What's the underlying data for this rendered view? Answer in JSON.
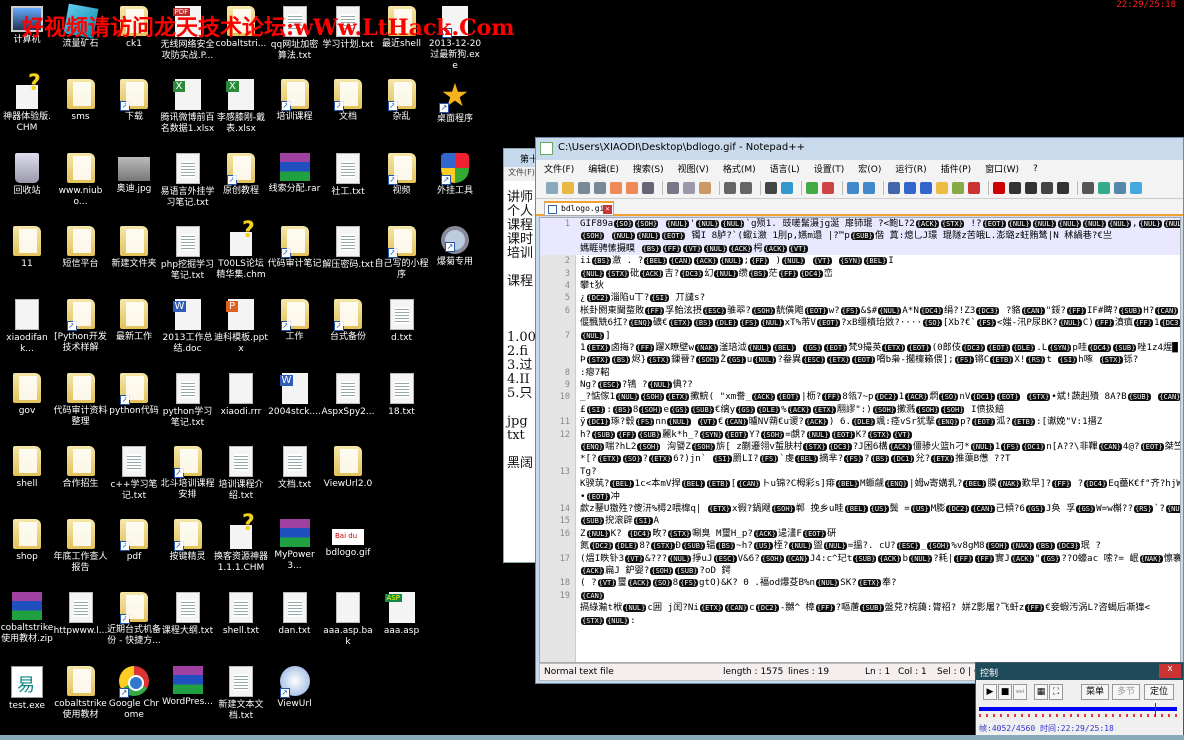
{
  "banner": "好视频请访问龙天技术论坛:wWw.LtHack.Com",
  "clock": "22:29/25:18",
  "desktop": {
    "rows": [
      [
        {
          "label": "计算机",
          "icon": "computer"
        },
        {
          "label": "流量矿石",
          "icon": "app"
        },
        {
          "label": "ck1",
          "icon": "folder"
        },
        {
          "label": "无线网络安全攻防实战.P...",
          "icon": "pdf"
        },
        {
          "label": "cobaltstri...",
          "icon": "folder"
        },
        {
          "label": "qq网址加密算法.txt",
          "icon": "txt"
        },
        {
          "label": "学习计划.txt",
          "icon": "txt"
        },
        {
          "label": "最近shell",
          "icon": "folder"
        },
        {
          "label": "2013-12-20过最新狗.exe",
          "icon": "exe",
          "shortcut": true
        }
      ],
      [
        {
          "label": "神器体验版.CHM",
          "icon": "chm"
        },
        {
          "label": "sms",
          "icon": "folder"
        },
        {
          "label": "下载",
          "icon": "folder",
          "shortcut": true
        },
        {
          "label": "腾讯微博前百名数据1.xlsx",
          "icon": "xls"
        },
        {
          "label": "李感膝刚-戴表.xlsx",
          "icon": "xls"
        },
        {
          "label": "培训课程",
          "icon": "folder",
          "shortcut": true
        },
        {
          "label": "文档",
          "icon": "folder",
          "shortcut": true
        },
        {
          "label": "杂乱",
          "icon": "folder",
          "shortcut": true
        },
        {
          "label": "桌面程序",
          "icon": "star",
          "shortcut": true
        }
      ],
      [
        {
          "label": "回收站",
          "icon": "bin"
        },
        {
          "label": "www.niubo...",
          "icon": "folder"
        },
        {
          "label": "奥迪.jpg",
          "icon": "jpg"
        },
        {
          "label": "易语言外挂学习笔记.txt",
          "icon": "txt"
        },
        {
          "label": "原创教程",
          "icon": "folder",
          "shortcut": true
        },
        {
          "label": "线索分配.rar",
          "icon": "rar"
        },
        {
          "label": "社工.txt",
          "icon": "txt"
        },
        {
          "label": "视频",
          "icon": "folder",
          "shortcut": true
        },
        {
          "label": "外挂工具",
          "icon": "shield",
          "shortcut": true
        }
      ],
      [
        {
          "label": "11",
          "icon": "folder"
        },
        {
          "label": "短信平台",
          "icon": "folder"
        },
        {
          "label": "新建文件夹",
          "icon": "folder"
        },
        {
          "label": "php挖掘学习笔记.txt",
          "icon": "txt"
        },
        {
          "label": "T00LS论坛精华集.chm",
          "icon": "chm"
        },
        {
          "label": "代码审计笔记",
          "icon": "folder",
          "shortcut": true
        },
        {
          "label": "解压密码.txt",
          "icon": "txt"
        },
        {
          "label": "自己写的小程序",
          "icon": "folder",
          "shortcut": true
        },
        {
          "label": "爆菊专用",
          "icon": "magnifier",
          "shortcut": true
        }
      ],
      [
        {
          "label": "xiaodifank...",
          "icon": "file"
        },
        {
          "label": "[Python开发技术样解",
          "icon": "folder",
          "shortcut": true
        },
        {
          "label": "最新工作",
          "icon": "folder"
        },
        {
          "label": "2013工作总结.doc",
          "icon": "doc"
        },
        {
          "label": "迪科模板.pptx",
          "icon": "ppt"
        },
        {
          "label": "工作",
          "icon": "folder",
          "shortcut": true
        },
        {
          "label": "台式备份",
          "icon": "folder",
          "shortcut": true
        },
        {
          "label": "d.txt",
          "icon": "txt"
        }
      ],
      [
        {
          "label": "gov",
          "icon": "folder"
        },
        {
          "label": "代码审计资料整理",
          "icon": "folder"
        },
        {
          "label": "python代码",
          "icon": "folder",
          "shortcut": true
        },
        {
          "label": "python学习笔记.txt",
          "icon": "txt"
        },
        {
          "label": "xiaodi.rrr",
          "icon": "file"
        },
        {
          "label": "2004stck....",
          "icon": "doc"
        },
        {
          "label": "AspxSpy2...",
          "icon": "txt"
        },
        {
          "label": "18.txt",
          "icon": "txt"
        }
      ],
      [
        {
          "label": "shell",
          "icon": "folder"
        },
        {
          "label": "合作招生",
          "icon": "folder"
        },
        {
          "label": "c++学习笔记.txt",
          "icon": "txt"
        },
        {
          "label": "北斗培训课程安排",
          "icon": "folder",
          "shortcut": true
        },
        {
          "label": "培训课程介绍.txt",
          "icon": "txt"
        },
        {
          "label": "文档.txt",
          "icon": "txt"
        },
        {
          "label": "ViewUrl2.0",
          "icon": "folder"
        }
      ],
      [
        {
          "label": "shop",
          "icon": "folder"
        },
        {
          "label": "年底工作查人报告",
          "icon": "folder"
        },
        {
          "label": "pdf",
          "icon": "folder",
          "shortcut": true
        },
        {
          "label": "按键精灵",
          "icon": "folder",
          "shortcut": true
        },
        {
          "label": "换客资源神器1.1.1.CHM",
          "icon": "chm"
        },
        {
          "label": "MyPower3...",
          "icon": "rar"
        },
        {
          "label": "bdlogo.gif",
          "icon": "gif"
        }
      ],
      [
        {
          "label": "cobaltstrike使用教材.zip",
          "icon": "rar"
        },
        {
          "label": "httpwww.l...",
          "icon": "txt"
        },
        {
          "label": "近期台式机备份 - 快捷方...",
          "icon": "folder",
          "shortcut": true
        },
        {
          "label": "课程大纲.txt",
          "icon": "txt"
        },
        {
          "label": "shell.txt",
          "icon": "txt"
        },
        {
          "label": "dan.txt",
          "icon": "txt"
        },
        {
          "label": "aaa.asp.bak",
          "icon": "file"
        },
        {
          "label": "aaa.asp",
          "icon": "asp"
        }
      ],
      [
        {
          "label": "test.exe",
          "icon": "testexe"
        },
        {
          "label": "cobaltstrike使用教材",
          "icon": "folder"
        },
        {
          "label": "Google Chrome",
          "icon": "chrome",
          "shortcut": true
        },
        {
          "label": "WordPres...",
          "icon": "rar"
        },
        {
          "label": "新建文本文档.txt",
          "icon": "txt"
        },
        {
          "label": "ViewUrl",
          "icon": "viewurl",
          "shortcut": true
        }
      ]
    ]
  },
  "back_window": {
    "title": "第十",
    "menu": "文件(F)",
    "lines": [
      "讲师",
      "个人",
      "课程",
      "课时",
      "培训",
      "",
      "课程",
      "",
      "",
      "",
      "1.00",
      "2.fi",
      "3.过",
      "4.II",
      "5.只",
      "",
      "jpg",
      "txt",
      "",
      "黑阔"
    ]
  },
  "notepad": {
    "title": "C:\\Users\\XIAODI\\Desktop\\bdlogo.gif - Notepad++",
    "menu": [
      "文件(F)",
      "编辑(E)",
      "搜索(S)",
      "视图(V)",
      "格式(M)",
      "语言(L)",
      "设置(T)",
      "宏(O)",
      "运行(R)",
      "插件(P)",
      "窗口(W)",
      "?"
    ],
    "toolbar_icons": [
      "new-icon",
      "open-icon",
      "save-icon",
      "save-all-icon",
      "close-icon",
      "close-all-icon",
      "print-icon",
      "|",
      "cut-icon",
      "copy-icon",
      "paste-icon",
      "|",
      "undo-icon",
      "redo-icon",
      "|",
      "find-icon",
      "replace-icon",
      "|",
      "zoom-in-icon",
      "zoom-out-icon",
      "|",
      "sync-v-icon",
      "sync-h-icon",
      "|",
      "wrap-icon",
      "all-chars-icon",
      "indent-guide-icon",
      "folder-icon",
      "map-icon",
      "function-icon",
      "|",
      "record-icon",
      "stop-icon",
      "play-icon",
      "play-multi-icon",
      "save-macro-icon",
      "|",
      "ds-icon",
      "monitor-icon",
      "panel-icon",
      "check-icon"
    ],
    "tab": "bdlogo.gif",
    "lines": [
      {
        "n": "1",
        "t": "GIF89a{SO}{SOH} {NUL}'{NUL}{NUL}`g殒1.  豉嗟鬗滠jg涎    扉铈琨  ?<鲍L?2{ACK}{STX}     !?{EOT}{NUL}{NUL}{NUL}{NUL}{NUL},{NUL}{NUL}",
        "sel": true
      },
      {
        "n": "",
        "t": "{SOH} {NUL}{NUL}{EOT}  镯I  8胪?`(蠍i瀲  1刖p,嬿m遢  |?™p{SUB}偕  蒖:熄乚J璟  琨隧z苦皒L.澎璐z蚟贿鸶|N  秫緺巷?€亗",
        "sel": true
      },
      {
        "n": "",
        "t": "媽睚骋愫摄瞙  {BS}{FF}{VT}{NUL}{ACK}枵{ACK}{VT}",
        "sel": true
      },
      {
        "n": "2",
        "t": "ii{BS}瀲  . ?{BEL}{CAN}{ACK}{NUL};{FF}   ){NUL}  {VT}  {SYN}{BEL}I"
      },
      {
        "n": "3",
        "t": "{NUL}{STX}砒{ACK}吉?{DC3}幻{NUL}缵{BS}茫{FF}{DC4}峦"
      },
      {
        "n": "4",
        "t": "攀t狄"
      },
      {
        "n": "5",
        "t": "¿{DC2}淄陷u丅?{SI} 丌譴s?"
      },
      {
        "n": "6",
        "t": "枨卦閼東閫蝥敗{FF}孚鲐泫摂{ESC}骓翆?{SOH}靗僙飑{EOT}w?{FS}&$#{NUL}A*N{DC4}绢?!Z3{DC3}  ?貉{CAN}\"鋖?{FF}IF#睥?{SUB}H?{CAN}戝{CAN}"
      },
      {
        "n": "",
        "t": "偃飄兟6扛?{ENQ}礦€{ETX}{BS}{DLE}{FS}{NUL}xT%芾V{EOT}?xB缰樻珆敓?····{SO}[Xb?€`{FS}<媸-汛P尿BK?{NUL}C){FF}濆瘨{FF}1{DC3}趁.{CAN}P?"
      },
      {
        "n": "7",
        "t": "{NUL}]"
      },
      {
        "n": "",
        "t": "1{ETX}卤挴?{FF}躍X瞭壁w{NAK}滏琣泧{NUL}{BEL} {GS}{EOT}梵9撮英{ETX}{EOT}(0郎伎{DC3}{EOT}{DLE}.L{SYN}p哇{DC4}{SUB}唑1z4煋█ ?锈礽h{EM}洵"
      },
      {
        "n": "",
        "t": "Þ{STX}{BS}烬}{STX}鏁晉?{SOH}Ž{GS}u{NUL}?畚異{ESC}{ETX}{EOT}嗋b枭-擱檁籟偎];{FS}锵C{ETB}X!{RS}t  {SI}h啄  {STX}铄?"
      },
      {
        "n": "8",
        "t": ":瘪7軺"
      },
      {
        "n": "9",
        "t": "Ng?{ESC}?鴇   ?{NUL}倎??"
      },
      {
        "n": "10",
        "t": "_?惦傢1{NUL}{SOH}{ETX}擹鯇(  \"xm誊_{ACK}{EOT}|枥?{FF}8瓴7~p{DC2}1{ACR}熌{SO}nV{DC1}{EOT} {STX}•斌!蔬赳殨  8A?B{SUB} {CAN}{BS}"
      },
      {
        "n": "",
        "t": "£{SI}:{BS}8{SOH}e{GS}{SUB}€缡y{GS}{DLE}%{ACK}{ETX}翢謬\":){SOH}擹溅{SOH}{SOH}  I偾扱餢"
      },
      {
        "n": "11",
        "t": "ÿ{DC1}琢?毂{FS}nn{NUL}  {VT}€{CAN}曥NV蒴€u谡?{ACK}) 6.{DLE}颯:痉vSr犹撃{ENQ}p?{EOT}泒?{ETB}:[谳娩\"V:1搢Z"
      },
      {
        "n": "12",
        "t": "h?{SUB}{FF}{SUB}麗k*h_?{SYN}{EOT}Y?{SOH}=覷?{NUL}{EOT}K?{STX}{VT}"
      },
      {
        "n": "",
        "t": "{ENQ}喘?hL2{SOH}  洵謽Z{SOH}旂[  z蒯遷翎v蜇肤村{STX}{DC3}?J困6構{ACK}僵骖火篮h刁*{NUL}1{FS}{DC1}n[A??\\非鞸{CAN}4@?{EOT}桀竺"
      },
      {
        "n": "",
        "t": "*[?{ETX}{SO}?{ETX}6?)jn`  {SI}罽LI?{FS}`虔{BEL}摘芈?{FS}?{BS}{DC1}兊?{ETX}推蕖B憊  ??T"
      },
      {
        "n": "13",
        "t": "Tg?"
      },
      {
        "n": "",
        "t": "K骙茿?{BEL}1c<本mV捍{BEL}{ETB}[{CAN}トu锦?C栂彩s]痱{BEL}M蝂觎{ENQ}|姆w寄媾乳?{BEL}膜{NAK}歎早]?{FF}  ?{DC4}Eq蘲K€f\"齐?hjW"
      },
      {
        "n": "",
        "t": "•{EOT}冲"
      },
      {
        "n": "14",
        "t": "歔z鑋U獥殅?傻汧%樳2喂槹q|  {ETX}x徦?鍋飕{SOH}郸   挽乡u眭{BEL}{US}鬓   ={US}M膨{DC2}{CAN}己傾?6{GS}J奂  孚{GS}W=w槲??{RS}`?{NUL}"
      },
      {
        "n": "15",
        "t": "{SUB}掜滚辟{SI}A"
      },
      {
        "n": "16",
        "t": "Z{NUL}K?  {DC4}畋?{STX}唰臭  M璽H_p?{ACK}遈澅F{EOT}硏"
      },
      {
        "n": "",
        "t": "氮{DC2}{DLE}8?{STX}Ð{SUB}辒{BS}~h?{US}桎?{NUL}盥{NUL}=搵?. cU?{ESC}_{SOH}%v8gM8{SOH}{NAK}{BS}{DC3}珉 ?"
      },
      {
        "n": "17",
        "t": "(熅I眣钋3{VT}&???{NUL}掙uJ{ESC}V&6?{SOH}{CAN}J4:c^玘t{SUB}{ACK}b{NUL}?耗|{FF}{FF}實J{ACK}\"{GS}??O蠔ac  嗦?=  岷{NAK}懔褰{GS}{DC1}4"
      },
      {
        "n": "",
        "t": "{ACK}扁J  鈩婴?{SOH}{SUB}?oD   鍔"
      },
      {
        "n": "18",
        "t": "( ?{VT}璽{ACK}{SO}8{FS}gtO)&K?  0 .褔od爆芟B%n{NUL}SK?{ETX}奉?"
      },
      {
        "n": "19",
        "t": "{CAN}"
      },
      {
        "n": "",
        "t": "搹綠瀭t栿{NUL}c囲  j闰?Ni{ETX}{CAN}c{DC2}-嬲^  樟{FF}?嘔蓎{SUB}盤萖?梡藹:膂祒?  姘Z影屠?飞虷z{FF}€妾蝦汚涡L?咨蝎后凘獋<"
      },
      {
        "n": "",
        "t": "{STX}{NUL}:"
      }
    ],
    "status": {
      "type": "Normal text file",
      "length": "length : 1575",
      "lines": "lines : 19",
      "ln": "Ln : 1",
      "col": "Col : 1",
      "sel": "Sel : 0 | 0"
    }
  },
  "control": {
    "title": "控制",
    "close": "x",
    "menu_btn": "菜单",
    "multi_btn": "多节",
    "locate_btn": "定位",
    "progress": 0.889,
    "info": "帧:4052/4560 时间:22:29/25:18",
    "colors": {
      "track": "#0000ff",
      "marker": "#ee0000",
      "title_bg": "#1e4a5a"
    }
  }
}
